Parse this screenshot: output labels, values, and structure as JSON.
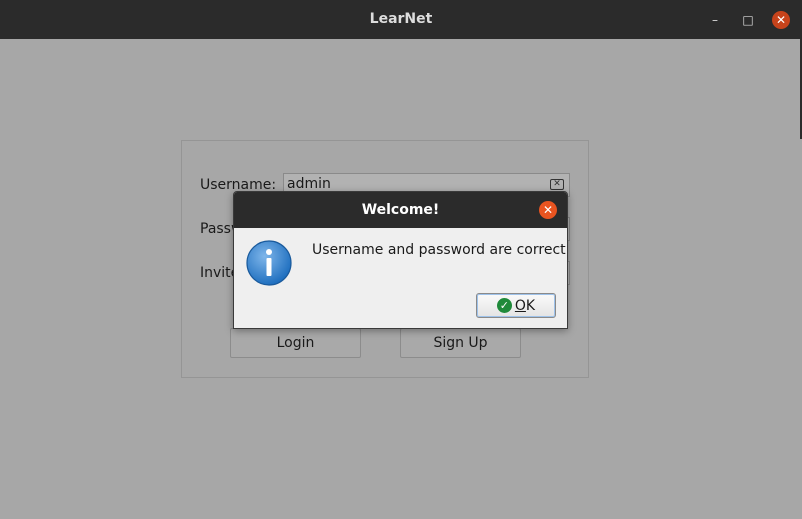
{
  "window": {
    "title": "LearNet",
    "minimize_glyph": "–",
    "maximize_glyph": "□",
    "close_glyph": "✕"
  },
  "form": {
    "username_label": "Username:",
    "username_value": "admin",
    "password_label": "Passw",
    "invite_label": "Invite",
    "login_label": "Login",
    "signup_label": "Sign Up"
  },
  "dialog": {
    "title": "Welcome!",
    "close_glyph": "✕",
    "message": "Username and password are correct",
    "ok_mnemonic": "O",
    "ok_rest": "K"
  },
  "colors": {
    "titlebar": "#2b2b2b",
    "background": "#a7a7a7",
    "close_accent": "#e95420",
    "info_blue": "#2d7fd0",
    "ok_green": "#1f8a3a"
  },
  "icons": [
    "minimize-icon",
    "maximize-icon",
    "close-icon",
    "clear-text-icon",
    "info-icon",
    "checkmark-icon"
  ]
}
